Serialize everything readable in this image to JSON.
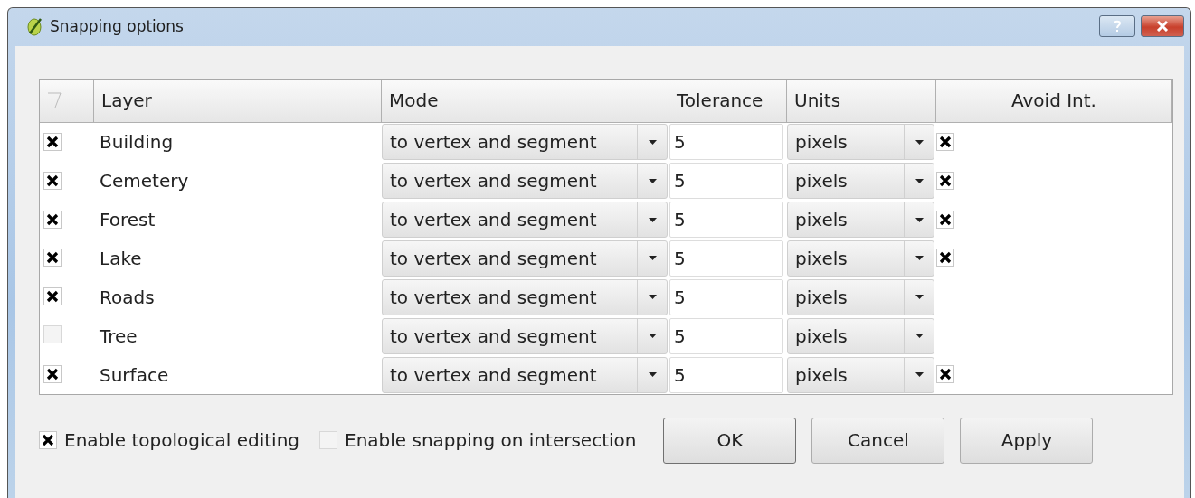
{
  "window": {
    "title": "Snapping options"
  },
  "table": {
    "columns": [
      "Layer",
      "Mode",
      "Tolerance",
      "Units",
      "Avoid Int."
    ],
    "rows": [
      {
        "checked": true,
        "layer": "Building",
        "mode": "to vertex and segment",
        "tolerance": "5",
        "units": "pixels",
        "avoid_int": true
      },
      {
        "checked": true,
        "layer": "Cemetery",
        "mode": "to vertex and segment",
        "tolerance": "5",
        "units": "pixels",
        "avoid_int": true
      },
      {
        "checked": true,
        "layer": "Forest",
        "mode": "to vertex and segment",
        "tolerance": "5",
        "units": "pixels",
        "avoid_int": true
      },
      {
        "checked": true,
        "layer": "Lake",
        "mode": "to vertex and segment",
        "tolerance": "5",
        "units": "pixels",
        "avoid_int": true
      },
      {
        "checked": true,
        "layer": "Roads",
        "mode": "to vertex and segment",
        "tolerance": "5",
        "units": "pixels",
        "avoid_int": false
      },
      {
        "checked": false,
        "layer": "Tree",
        "mode": "to vertex and segment",
        "tolerance": "5",
        "units": "pixels",
        "avoid_int": false
      },
      {
        "checked": true,
        "layer": "Surface",
        "mode": "to vertex and segment",
        "tolerance": "5",
        "units": "pixels",
        "avoid_int": true
      }
    ]
  },
  "options": [
    {
      "label": "Enable topological editing",
      "checked": true
    },
    {
      "label": "Enable snapping on intersection",
      "checked": false
    }
  ],
  "buttons": [
    "OK",
    "Cancel",
    "Apply"
  ]
}
